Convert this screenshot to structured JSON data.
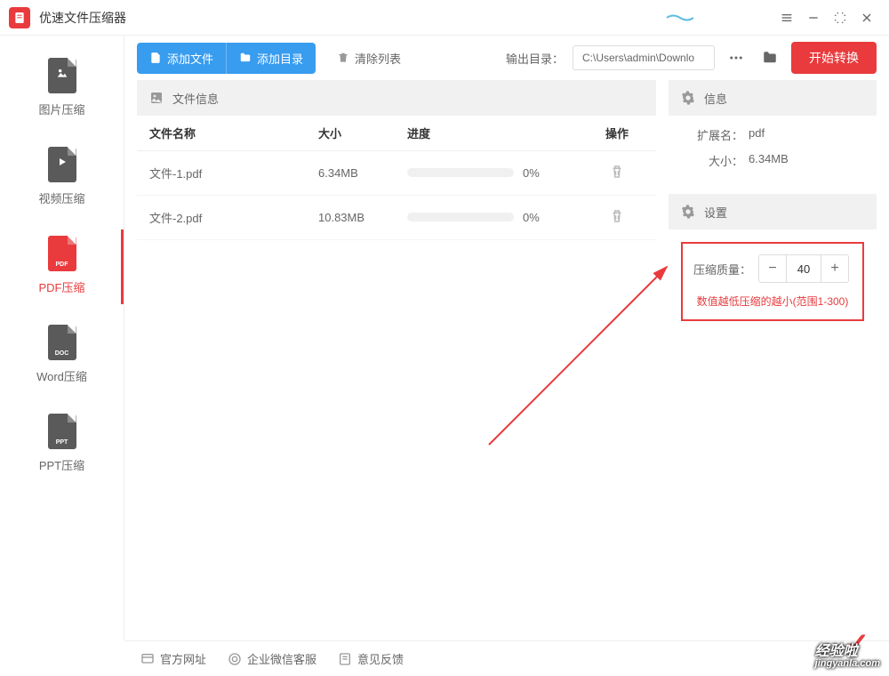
{
  "app": {
    "title": "优速文件压缩器"
  },
  "sidebar": {
    "items": [
      {
        "label": "图片压缩",
        "badge": ""
      },
      {
        "label": "视频压缩",
        "badge": ""
      },
      {
        "label": "PDF压缩",
        "badge": "PDF"
      },
      {
        "label": "Word压缩",
        "badge": "DOC"
      },
      {
        "label": "PPT压缩",
        "badge": "PPT"
      }
    ]
  },
  "toolbar": {
    "add_file": "添加文件",
    "add_dir": "添加目录",
    "clear": "清除列表",
    "output_label": "输出目录：",
    "output_path": "C:\\Users\\admin\\Downlo",
    "convert": "开始转换"
  },
  "file_panel": {
    "header": "文件信息",
    "columns": {
      "name": "文件名称",
      "size": "大小",
      "progress": "进度",
      "action": "操作"
    },
    "rows": [
      {
        "name": "文件-1.pdf",
        "size": "6.34MB",
        "progress": "0%"
      },
      {
        "name": "文件-2.pdf",
        "size": "10.83MB",
        "progress": "0%"
      }
    ]
  },
  "info": {
    "header": "信息",
    "ext_label": "扩展名：",
    "ext_value": "pdf",
    "size_label": "大小：",
    "size_value": "6.34MB"
  },
  "settings": {
    "header": "设置",
    "quality_label": "压缩质量：",
    "quality_value": "40",
    "hint": "数值越低压缩的越小(范围1-300)"
  },
  "footer": {
    "site": "官方网址",
    "support": "企业微信客服",
    "feedback": "意见反馈"
  },
  "watermark": {
    "main": "经验啦",
    "sub": "jingyanla.com"
  }
}
